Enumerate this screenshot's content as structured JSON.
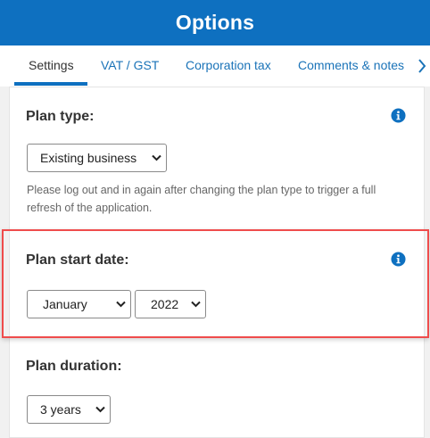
{
  "header": {
    "title": "Options"
  },
  "tabs": [
    {
      "label": "Settings",
      "active": true
    },
    {
      "label": "VAT / GST",
      "active": false
    },
    {
      "label": "Corporation tax",
      "active": false
    },
    {
      "label": "Comments & notes",
      "active": false
    }
  ],
  "tabs_next_icon": "chevron-right-icon",
  "plan_type": {
    "title": "Plan type:",
    "selected": "Existing business",
    "help": "Please log out and in again after changing the plan type to trigger a full refresh of the application."
  },
  "plan_start_date": {
    "title": "Plan start date:",
    "month": "January",
    "year": "2022"
  },
  "plan_duration": {
    "title": "Plan duration:",
    "selected": "3 years"
  },
  "colors": {
    "brand": "#0e70c0",
    "highlight": "#ef4c4c",
    "link": "#1a73b8"
  }
}
